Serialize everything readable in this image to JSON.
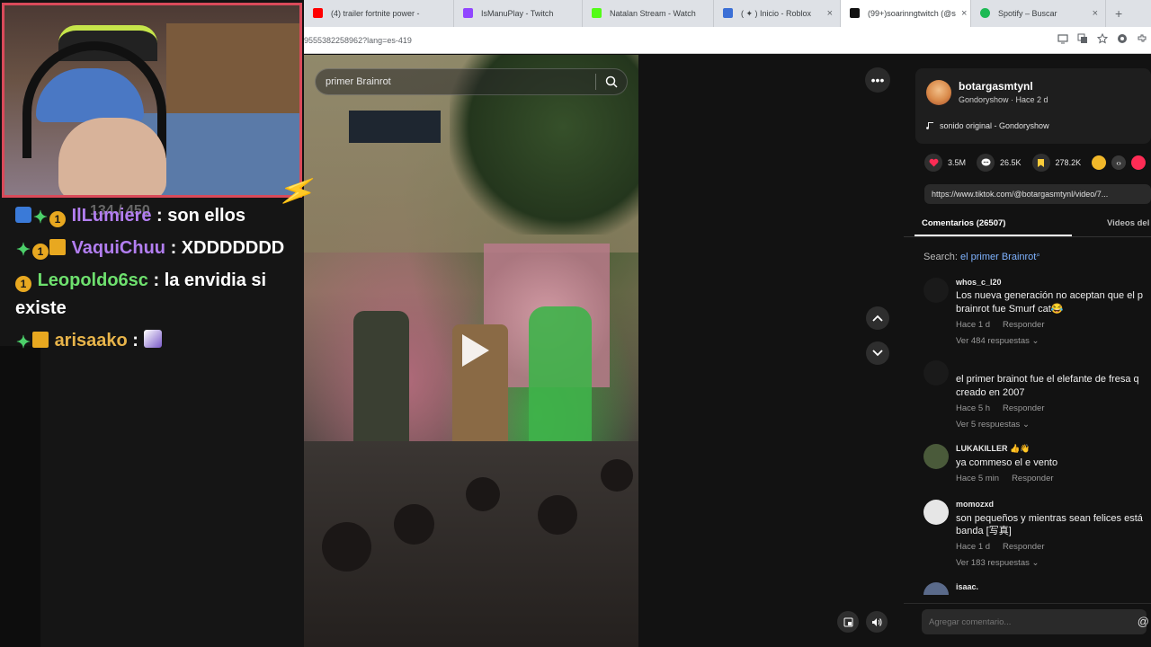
{
  "browser": {
    "tabs": [
      {
        "title": "(4) trailer fortnite power -",
        "color": "#ff0000",
        "active": false
      },
      {
        "title": "IsManuPlay - Twitch",
        "color": "#9146ff",
        "active": false
      },
      {
        "title": "Natalan Stream - Watch",
        "color": "#53fc18",
        "active": false
      },
      {
        "title": "( ✦ ) Inicio - Roblox",
        "color": "#3b6fd6",
        "active": false
      },
      {
        "title": "(99+)soarinngtwitch (@s",
        "color": "#111111",
        "active": true
      },
      {
        "title": "Spotify – Buscar",
        "color": "#1db954",
        "active": false
      }
    ],
    "close_glyph": "×",
    "newtab_glyph": "+",
    "url": "9555382258962?lang=es-419"
  },
  "tiktok": {
    "search": {
      "value": "primer Brainrot"
    },
    "more_glyph": "•••",
    "author": "botargasmtynl",
    "subtitle": "Gondoryshow · Hace 2 d",
    "music": "sonido original - Gondoryshow",
    "stats": {
      "likes": "3.5M",
      "comments": "26.5K",
      "saves": "278.2K"
    },
    "link": "https://www.tiktok.com/@botargasmtynl/video/7...",
    "tabs": {
      "comments": "Comentarios (26507)",
      "videos": "Videos del"
    },
    "search_line": {
      "label": "Search:",
      "keyword": "el primer Brainrot"
    },
    "comments": [
      {
        "user": "whos_c_l20",
        "text1": "Los nueva generación no aceptan que el p",
        "text2": "brainrot fue Smurf cat😂",
        "time": "Hace 1 d",
        "reply": "Responder",
        "replies": "Ver 484 respuestas"
      },
      {
        "user": "",
        "text1": "el primer brainot fue el elefante de fresa q",
        "text2": "creado en 2007",
        "time": "Hace 5 h",
        "reply": "Responder",
        "replies": "Ver 5 respuestas"
      },
      {
        "user": "LUKAKILLER 👍👋",
        "text1": "ya commeso el e vento",
        "text2": "",
        "time": "Hace 5 min",
        "reply": "Responder",
        "replies": ""
      },
      {
        "user": "momozxd",
        "text1": "son pequeños y mientras sean felices está",
        "text2": "banda [写真]",
        "time": "Hace 1 d",
        "reply": "Responder",
        "replies": "Ver 183 respuestas"
      },
      {
        "user": "isaac.",
        "text1": "",
        "text2": "",
        "time": "",
        "reply": "",
        "replies": ""
      }
    ],
    "add_comment_placeholder": "Agregar comentario...",
    "at_glyph": "@"
  },
  "stream": {
    "ghost_text": "134 / 450",
    "chat": [
      {
        "user": "IlLumiere",
        "user_color": "#b27ef0",
        "msg": " : son ellos"
      },
      {
        "user": "VaquiChuu",
        "user_color": "#b27ef0",
        "msg": " : XDDDDDDD"
      },
      {
        "user": "Leopoldo6sc",
        "user_color": "#6ee06e",
        "msg": " : la envidia si"
      },
      {
        "user": "",
        "user_color": "#ffffff",
        "msg": "existe"
      },
      {
        "user": "arisaako",
        "user_color": "#e8b44a",
        "msg": " : "
      }
    ],
    "badge_one": "1"
  }
}
